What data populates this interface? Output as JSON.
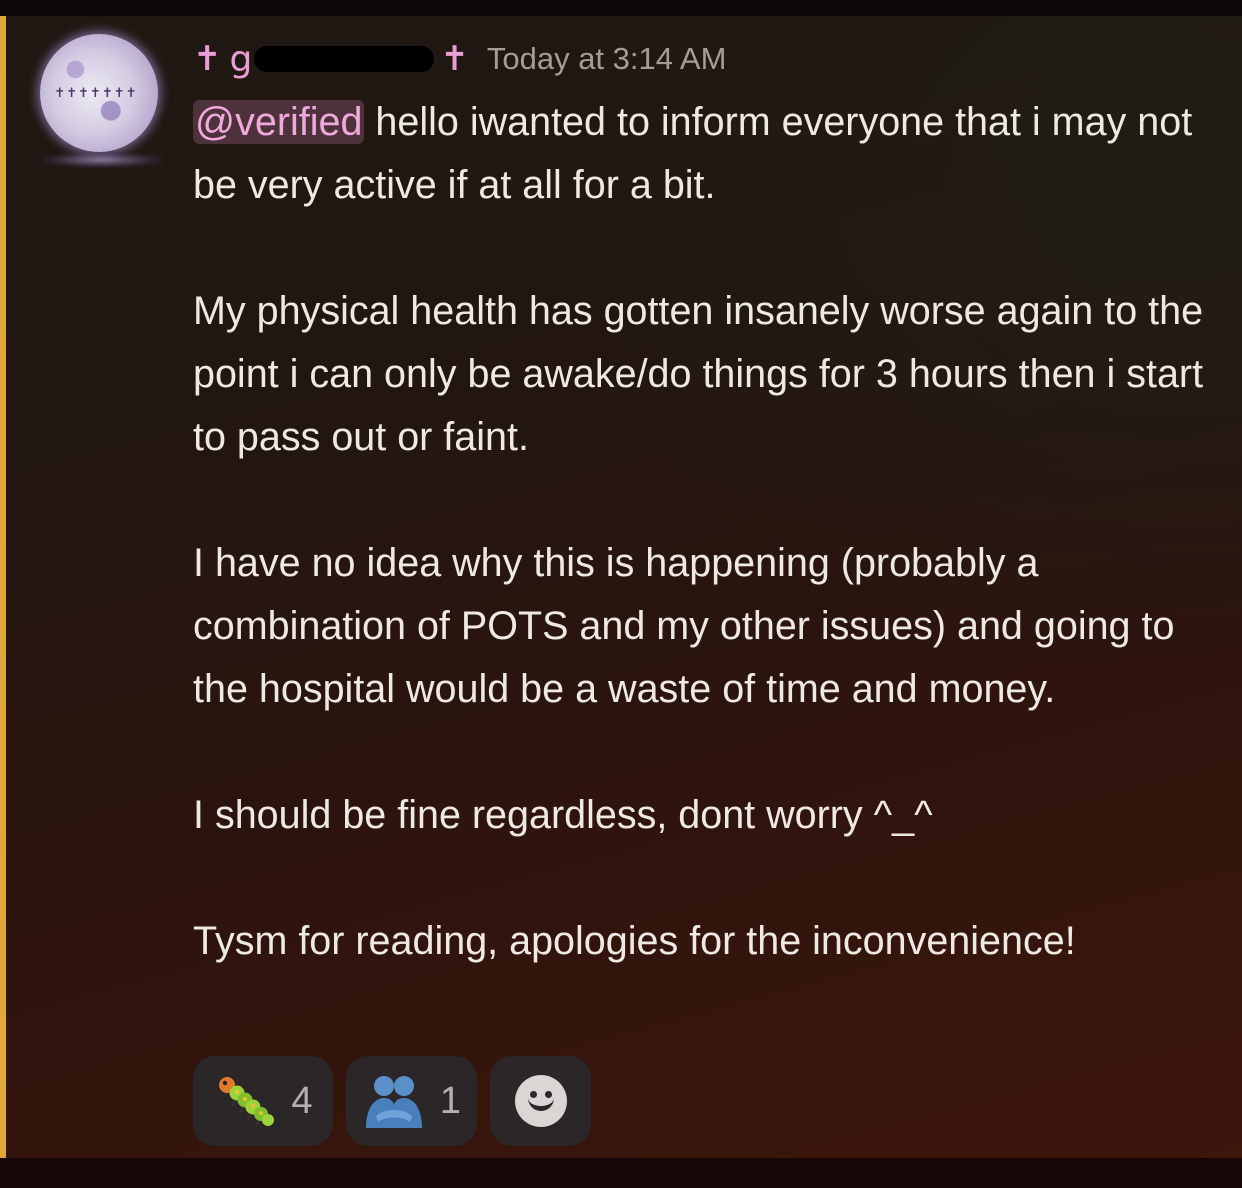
{
  "message": {
    "author": {
      "prefix_symbol": "✝",
      "visible_name_start": "g",
      "suffix_symbol": "✝",
      "avatar_decoration_text": "✝✝✝✝✝✝✝"
    },
    "timestamp": "Today at 3:14 AM",
    "mention": "@verified",
    "paragraphs": [
      " hello iwanted to inform everyone that i may not be very active if at all for a bit.",
      "My physical health has gotten insanely worse again to the point i can only be awake/do things for 3 hours then i start to pass out or faint.",
      "I have no idea why this is happening (probably a combination of POTS and my other issues) and going to the hospital would be a waste of time and money.",
      "I should be fine regardless, dont worry ^_^",
      "Tysm for reading, apologies for the inconvenience!"
    ],
    "reactions": [
      {
        "icon": "caterpillar-icon",
        "count": "4"
      },
      {
        "icon": "people-hugging-icon",
        "count": "1"
      }
    ],
    "add_reaction_icon": "smiley-add-reaction-icon"
  },
  "colors": {
    "accent_bar": "#e0a83a",
    "username": "#ec9bd9",
    "mention_text": "#f0a9dc",
    "timestamp": "#a39c98",
    "message_text": "#efe9e4",
    "reaction_bg": "#2b2628"
  }
}
